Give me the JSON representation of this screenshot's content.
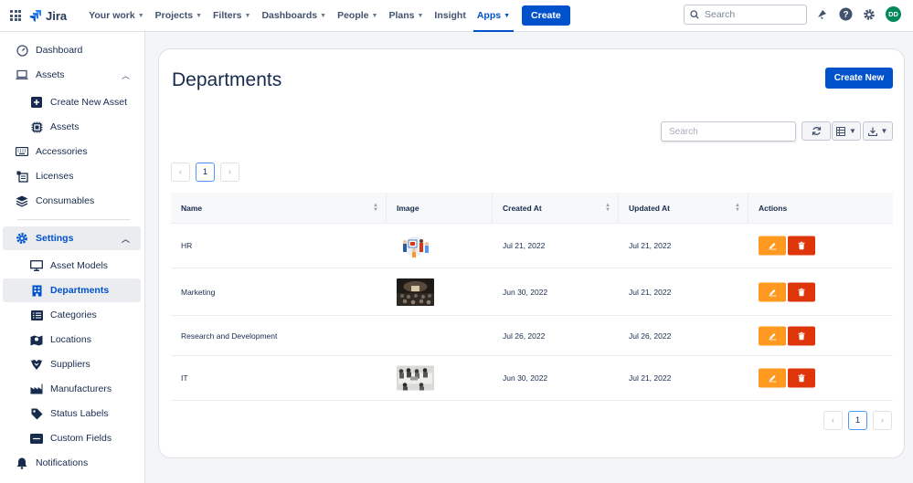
{
  "topnav": {
    "brand": "Jira",
    "items": [
      {
        "label": "Your work",
        "chevron": true
      },
      {
        "label": "Projects",
        "chevron": true
      },
      {
        "label": "Filters",
        "chevron": true
      },
      {
        "label": "Dashboards",
        "chevron": true
      },
      {
        "label": "People",
        "chevron": true
      },
      {
        "label": "Plans",
        "chevron": true
      },
      {
        "label": "Insight",
        "chevron": false
      },
      {
        "label": "Apps",
        "chevron": true,
        "active": true
      }
    ],
    "create_label": "Create",
    "search_placeholder": "Search",
    "avatar_initials": "DD"
  },
  "sidebar": {
    "dashboard": "Dashboard",
    "assets": "Assets",
    "create_new_asset": "Create New Asset",
    "assets_sub": "Assets",
    "accessories": "Accessories",
    "licenses": "Licenses",
    "consumables": "Consumables",
    "settings": "Settings",
    "asset_models": "Asset Models",
    "departments": "Departments",
    "categories": "Categories",
    "locations": "Locations",
    "suppliers": "Suppliers",
    "manufacturers": "Manufacturers",
    "status_labels": "Status Labels",
    "custom_fields": "Custom Fields",
    "notifications": "Notifications"
  },
  "main": {
    "title": "Departments",
    "create_new_label": "Create New",
    "search_placeholder": "Search",
    "page_current": "1",
    "columns": [
      "Name",
      "Image",
      "Created At",
      "Updated At",
      "Actions"
    ],
    "rows": [
      {
        "name": "HR",
        "image": "team-illustration",
        "created_at": "Jul 21, 2022",
        "updated_at": "Jul 21, 2022"
      },
      {
        "name": "Marketing",
        "image": "conference-photo",
        "created_at": "Jun 30, 2022",
        "updated_at": "Jul 21, 2022"
      },
      {
        "name": "Research and Development",
        "image": "",
        "created_at": "Jul 26, 2022",
        "updated_at": "Jul 26, 2022"
      },
      {
        "name": "IT",
        "image": "office-photo",
        "created_at": "Jun 30, 2022",
        "updated_at": "Jul 21, 2022"
      }
    ]
  },
  "colors": {
    "primary": "#0052cc",
    "edit": "#ff991f",
    "delete": "#de350b",
    "avatar": "#00875a"
  }
}
